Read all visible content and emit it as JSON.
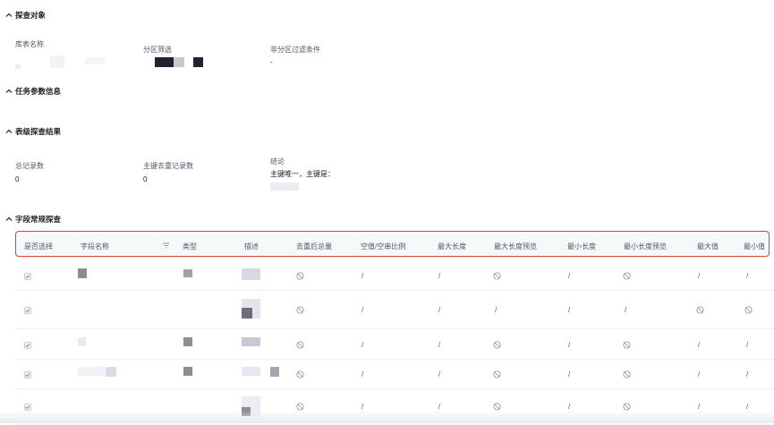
{
  "sections": {
    "probe_object": {
      "title": "探查对象",
      "table_name_label": "库表名称",
      "partition_label": "分区筛选",
      "non_partition_label": "非分区过滤条件",
      "non_partition_value": "-"
    },
    "task_params": {
      "title": "任务参数信息"
    },
    "table_level": {
      "title": "表级探查结果",
      "total_label": "总记录数",
      "total_value": "0",
      "dedup_label": "主键去重记录数",
      "dedup_value": "0",
      "conclusion_label": "结论",
      "conclusion_value": "主键唯一，主键是："
    },
    "field_probe": {
      "title": "字段常规探查"
    }
  },
  "table": {
    "headers": [
      "是否选择",
      "字段名称",
      "类型",
      "描述",
      "去重后总量",
      "空值/空串比例",
      "最大长度",
      "最大长度预览",
      "最小长度",
      "最小长度预览",
      "最大值",
      "最小值"
    ],
    "rows": [
      {
        "checked": true,
        "dedup": "ban",
        "null_ratio": "/",
        "max_len": "/",
        "max_preview": "ban",
        "min_len": "/",
        "min_preview": "ban",
        "max_val": "/",
        "min_val": "/"
      },
      {
        "checked": true,
        "dedup": "ban",
        "null_ratio": "/",
        "max_len": "/",
        "max_preview": "/",
        "min_len": "/",
        "min_preview": "/",
        "max_val": "ban",
        "min_val": "ban"
      },
      {
        "checked": true,
        "dedup": "ban",
        "null_ratio": "/",
        "max_len": "/",
        "max_preview": "ban",
        "min_len": "/",
        "min_preview": "ban",
        "max_val": "/",
        "min_val": "/"
      },
      {
        "checked": true,
        "dedup": "ban",
        "null_ratio": "/",
        "max_len": "/",
        "max_preview": "ban",
        "min_len": "/",
        "min_preview": "ban",
        "max_val": "/",
        "min_val": "/"
      },
      {
        "checked": true,
        "dedup": "ban",
        "null_ratio": "/",
        "max_len": "/",
        "max_preview": "ban",
        "min_len": "/",
        "min_preview": "ban",
        "max_val": "/",
        "min_val": "/"
      }
    ]
  },
  "colors": {
    "highlight_border": "#e2402c",
    "header_bg": "#f7f8fa"
  },
  "icons": {
    "section_toggle": "chevron-up-icon",
    "disabled": "ban-icon",
    "filter": "filter-icon",
    "checkbox": "check-icon"
  }
}
